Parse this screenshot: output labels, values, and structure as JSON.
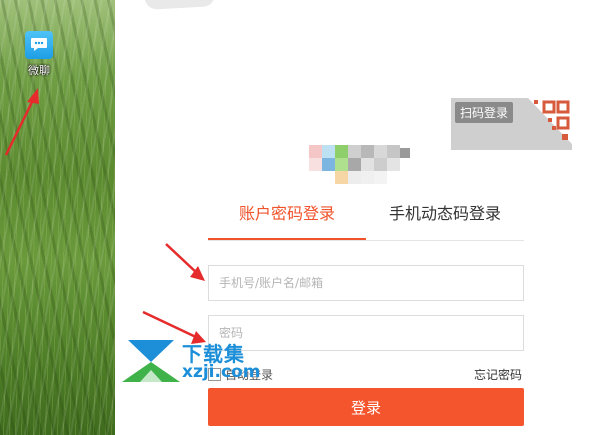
{
  "desktop": {
    "icon_label": "微聊",
    "icon_name": "chat-bubble-icon"
  },
  "qr": {
    "label": "扫码登录"
  },
  "tabs": [
    {
      "label": "账户密码登录",
      "active": true
    },
    {
      "label": "手机动态码登录",
      "active": false
    }
  ],
  "form": {
    "username_placeholder": "手机号/账户名/邮箱",
    "password_placeholder": "密码",
    "remember_label": "自动登录",
    "forgot_label": "忘记密码",
    "login_label": "登录"
  },
  "watermark": {
    "top": "下载集",
    "bottom": "xzji.com"
  },
  "colors": {
    "accent": "#f5552d",
    "active_tab": "#f0522a",
    "annotation_arrow": "#e52b2b",
    "watermark": "#1c8fd8"
  }
}
